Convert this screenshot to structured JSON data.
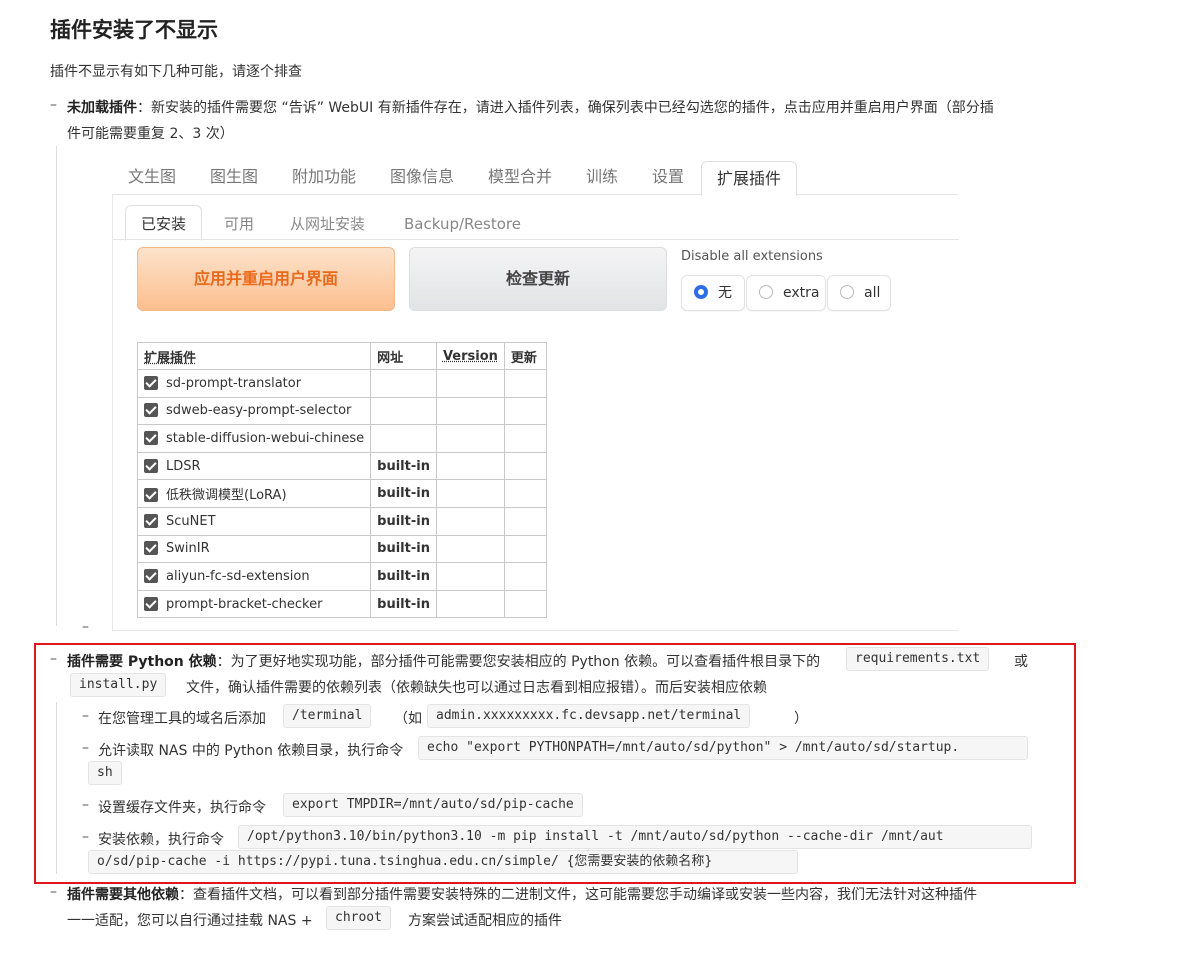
{
  "title": "插件安装了不显示",
  "intro": "插件不显示有如下几种可能，请逐个排查",
  "bullets": {
    "dash": "–",
    "item1_bold": "未加载插件",
    "item1_text": "：新安装的插件需要您 “告诉” WebUI 有新插件存在，请进入插件列表，确保列表中已经勾选您的插件，点击应用并重启用户界面（部分插",
    "item1_text2": "件可能需要重复 2、3 次）",
    "item2_bold": "插件需要 Python 依赖",
    "item2_text": "：为了更好地实现功能，部分插件可能需要您安装相应的 Python 依赖。可以查看插件根目录下的",
    "item2_code1": "requirements.txt",
    "item2_or": "或",
    "item2_code2": "install.py",
    "item2_text2": "文件，确认插件需要的依赖列表（依赖缺失也可以通过日志看到相应报错）。而后安装相应依赖",
    "sub1_text": "在您管理工具的域名后添加",
    "sub1_code": "/terminal",
    "sub1_paren_open": "（如",
    "sub1_code2": "admin.xxxxxxxxx.fc.devsapp.net/terminal",
    "sub1_paren_close": "）",
    "sub2_text": "允许读取 NAS 中的 Python 依赖目录，执行命令",
    "sub2_code": "echo \"export PYTHONPATH=/mnt/auto/sd/python\" > /mnt/auto/sd/startup.",
    "sub2_code_cont": "sh",
    "sub3_text": "设置缓存文件夹，执行命令",
    "sub3_code": "export TMPDIR=/mnt/auto/sd/pip-cache",
    "sub4_text": "安装依赖，执行命令",
    "sub4_code": "/opt/python3.10/bin/python3.10 -m pip install -t /mnt/auto/sd/python --cache-dir /mnt/aut",
    "sub4_code_cont": "o/sd/pip-cache -i https://pypi.tuna.tsinghua.edu.cn/simple/ {您需要安装的依赖名称}",
    "item3_bold": "插件需要其他依赖",
    "item3_text": "：查看插件文档，可以看到部分插件需要安装特殊的二进制文件，这可能需要您手动编译或安装一些内容，我们无法针对这种插件",
    "item3_text2_a": "一一适配，您可以自行通过挂载 NAS +",
    "item3_code": "chroot",
    "item3_text2_b": "方案尝试适配相应的插件"
  },
  "webui": {
    "tabs": [
      "文生图",
      "图生图",
      "附加功能",
      "图像信息",
      "模型合并",
      "训练",
      "设置",
      "扩展插件"
    ],
    "active_tab": "扩展插件",
    "subtabs": [
      "已安装",
      "可用",
      "从网址安装",
      "Backup/Restore"
    ],
    "apply_button": "应用并重启用户界面",
    "check_button": "检查更新",
    "disable_label": "Disable all extensions",
    "radio_options": [
      "无",
      "extra",
      "all"
    ],
    "radio_selected": "无",
    "table_headers": [
      "扩展插件",
      "网址",
      "Version",
      "更新"
    ],
    "rows": [
      {
        "name": "sd-prompt-translator",
        "url": "",
        "checked": true
      },
      {
        "name": "sdweb-easy-prompt-selector",
        "url": "",
        "checked": true
      },
      {
        "name": "stable-diffusion-webui-chinese",
        "url": "",
        "checked": true
      },
      {
        "name": "LDSR",
        "url": "built-in",
        "checked": true
      },
      {
        "name": "低秩微调模型(LoRA)",
        "url": "built-in",
        "checked": true
      },
      {
        "name": "ScuNET",
        "url": "built-in",
        "checked": true
      },
      {
        "name": "SwinIR",
        "url": "built-in",
        "checked": true
      },
      {
        "name": "aliyun-fc-sd-extension",
        "url": "built-in",
        "checked": true
      },
      {
        "name": "prompt-bracket-checker",
        "url": "built-in",
        "checked": true
      }
    ]
  },
  "colors": {
    "highlight_border": "#e0161b",
    "apply_text": "#ea6a1a",
    "radio_accent": "#2f6de8"
  }
}
